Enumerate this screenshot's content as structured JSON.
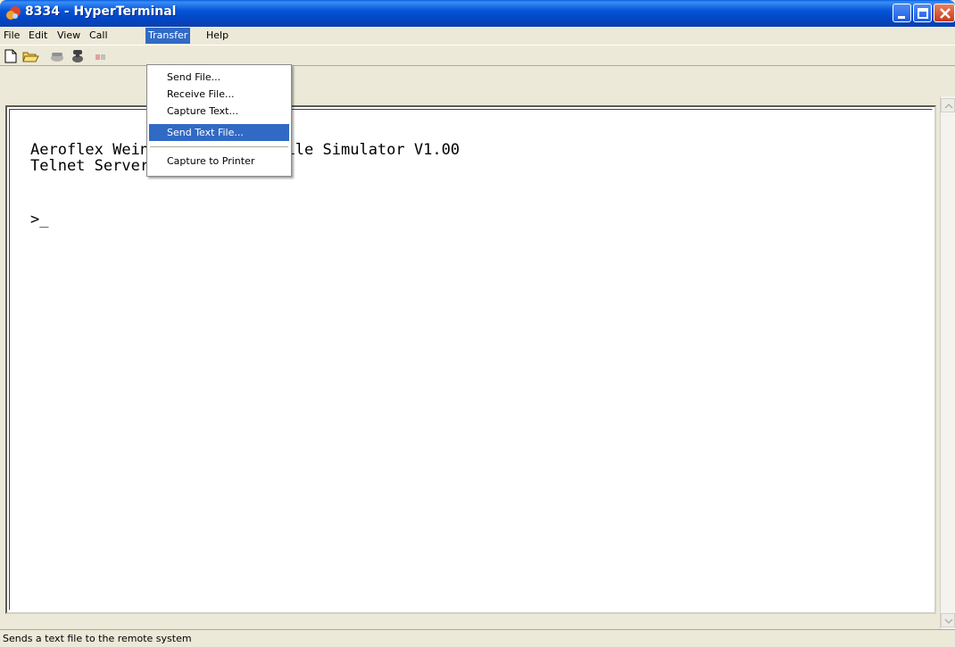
{
  "window": {
    "title": "8334 - HyperTerminal"
  },
  "menubar": {
    "items": [
      "File",
      "Edit",
      "View",
      "Call",
      "Transfer",
      "Help"
    ],
    "active": "Transfer"
  },
  "transfer_menu": {
    "items": [
      "Send File...",
      "Receive File...",
      "Capture Text...",
      "Send Text File...",
      "Capture to Printer"
    ],
    "selected": "Send Text File..."
  },
  "terminal": {
    "line1": "Aeroflex Weinschel Attn Profile Simulator V1.00",
    "line2": "Telnet Server",
    "prompt": ">_"
  },
  "toolbar": {
    "icons": [
      "new-icon",
      "open-icon",
      "connect-icon",
      "disconnect-icon",
      "send-icon",
      "properties-icon"
    ]
  },
  "statusbar": {
    "text": "Sends a text file to the remote system"
  },
  "colors": {
    "title_blue": "#0454d8",
    "menu_highlight": "#316ac5",
    "close_red": "#c53a1b"
  }
}
